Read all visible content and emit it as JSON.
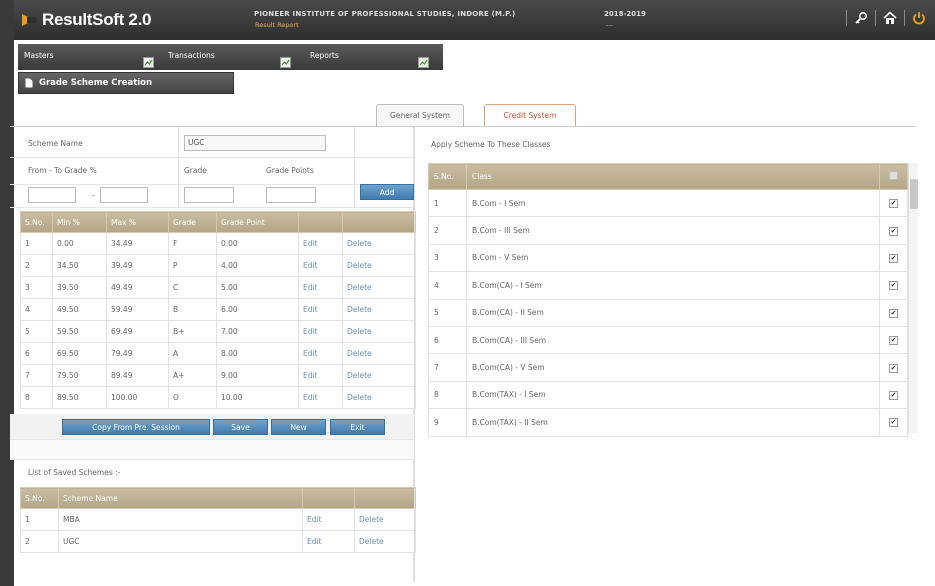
{
  "header": {
    "app_name": "ResultSoft 2.0",
    "institute": "PIONEER INSTITUTE OF PROFESSIONAL STUDIES, INDORE (M.P.)",
    "institute_sub": "Result Report",
    "session": "2018-2019",
    "session_sub": "---",
    "icons": [
      "key-icon",
      "home-icon",
      "power-icon"
    ]
  },
  "menu": {
    "items": [
      "Masters",
      "Transactions",
      "Reports"
    ]
  },
  "page_title": "Grade Scheme Creation",
  "tabs": [
    {
      "label": "General System",
      "active": false
    },
    {
      "label": "Credit System",
      "active": true
    }
  ],
  "form": {
    "scheme_name_label": "Scheme Name",
    "scheme_name_value": "UGC",
    "from_to_label": "From  - To Grade %",
    "dash": "-",
    "grade_label": "Grade",
    "grade_points_label": "Grade Points",
    "add_label": "Add"
  },
  "grades_table": {
    "headers": [
      "S.No.",
      "Min %",
      "Max %",
      "Grade",
      "Grade Point",
      "",
      ""
    ],
    "rows": [
      [
        "1",
        "0.00",
        "34.49",
        "F",
        "0.00",
        "Edit",
        "Delete"
      ],
      [
        "2",
        "34.50",
        "39.49",
        "P",
        "4.00",
        "Edit",
        "Delete"
      ],
      [
        "3",
        "39.50",
        "49.49",
        "C",
        "5.00",
        "Edit",
        "Delete"
      ],
      [
        "4",
        "49.50",
        "59.49",
        "B",
        "6.00",
        "Edit",
        "Delete"
      ],
      [
        "5",
        "59.50",
        "69.49",
        "B+",
        "7.00",
        "Edit",
        "Delete"
      ],
      [
        "6",
        "69.50",
        "79.49",
        "A",
        "8.00",
        "Edit",
        "Delete"
      ],
      [
        "7",
        "79.50",
        "89.49",
        "A+",
        "9.00",
        "Edit",
        "Delete"
      ],
      [
        "8",
        "89.50",
        "100.00",
        "O",
        "10.00",
        "Edit",
        "Delete"
      ]
    ]
  },
  "actions": {
    "copy": "Copy From Pre. Session",
    "save": "Save",
    "new": "New",
    "exit": "Exit"
  },
  "saved": {
    "title": "List of Saved Schemes :-",
    "headers": [
      "S.No.",
      "Scheme Name",
      "",
      ""
    ],
    "rows": [
      [
        "1",
        "MBA",
        "Edit",
        "Delete"
      ],
      [
        "2",
        "UGC",
        "Edit",
        "Delete"
      ]
    ]
  },
  "classes": {
    "title": "Apply Scheme To These Classes",
    "headers": [
      "S.No.",
      "Class"
    ],
    "rows": [
      [
        "1",
        "B.Com - I Sem"
      ],
      [
        "2",
        "B.Com - III Sem"
      ],
      [
        "3",
        "B.Com - V Sem"
      ],
      [
        "4",
        "B.Com(CA) - I Sem"
      ],
      [
        "5",
        "B.Com(CA) - II Sem"
      ],
      [
        "6",
        "B.Com(CA) - III Sem"
      ],
      [
        "7",
        "B.Com(CA) - V Sem"
      ],
      [
        "8",
        "B.Com(TAX) - I Sem"
      ],
      [
        "9",
        "B.Com(TAX) - II Sem"
      ]
    ]
  },
  "colors": {
    "accent": "#3f7bb0",
    "header_bg": "#2e2e2e",
    "table_header": "#b3a584",
    "active_tab": "#cc5533",
    "logo_orange": "#f29a1d"
  }
}
